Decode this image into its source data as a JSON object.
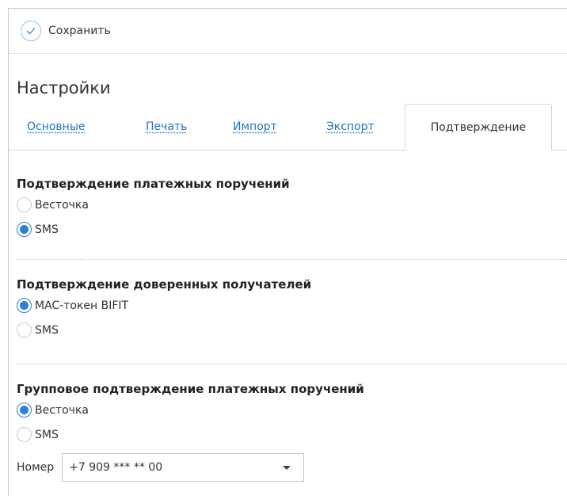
{
  "toolbar": {
    "save_label": "Сохранить"
  },
  "page_title": "Настройки",
  "tabs": [
    {
      "label": "Основные"
    },
    {
      "label": "Печать"
    },
    {
      "label": "Импорт"
    },
    {
      "label": "Экспорт"
    },
    {
      "label": "Подтверждение",
      "active": true
    }
  ],
  "sections": [
    {
      "title": "Подтверждение платежных поручений",
      "options": [
        {
          "label": "Весточка",
          "checked": false
        },
        {
          "label": "SMS",
          "checked": true
        }
      ]
    },
    {
      "title": "Подтверждение доверенных получателей",
      "options": [
        {
          "label": "MAC-токен BIFIT",
          "checked": true
        },
        {
          "label": "SMS",
          "checked": false
        }
      ]
    },
    {
      "title": "Групповое подтверждение платежных поручений",
      "options": [
        {
          "label": "Весточка",
          "checked": true
        },
        {
          "label": "SMS",
          "checked": false
        }
      ]
    }
  ],
  "number_field": {
    "label": "Номер",
    "value": "+7 909 *** ** 00"
  },
  "colors": {
    "accent": "#2d80d4",
    "link": "#1e73c8",
    "border": "#c8c8c8"
  }
}
